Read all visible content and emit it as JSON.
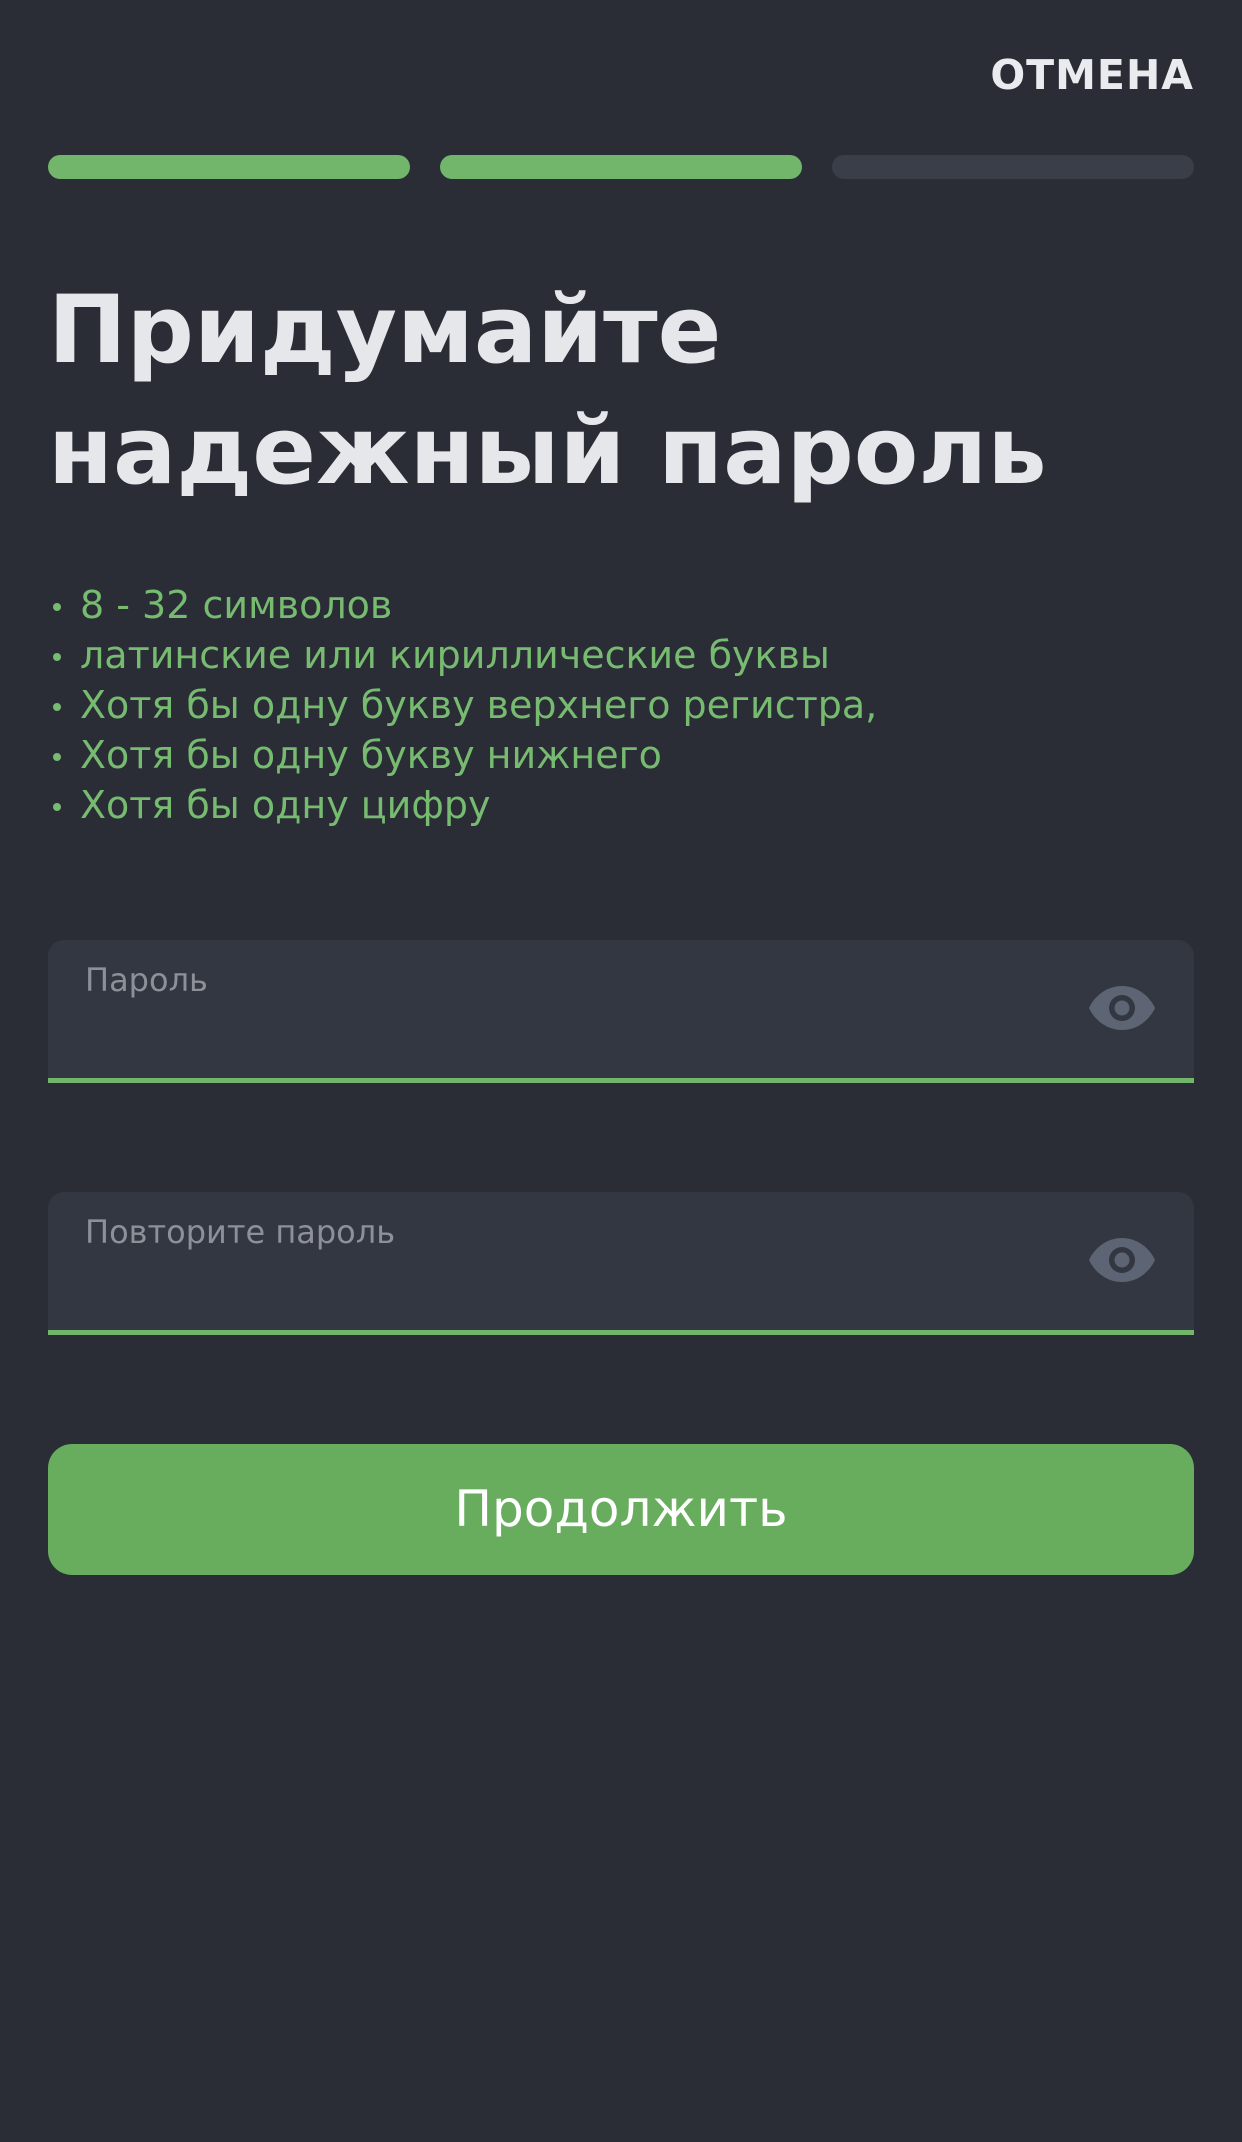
{
  "header": {
    "cancel_label": "ОТМЕНА"
  },
  "progress": {
    "steps_total": 3,
    "steps_completed": 2
  },
  "title": {
    "line1": "Придумайте",
    "line2": "надежный пароль"
  },
  "requirements": [
    "8 - 32 символов",
    "латинские или кириллические буквы",
    "Хотя бы одну букву верхнего регистра,",
    "Хотя бы одну букву нижнего",
    "Хотя бы одну цифру"
  ],
  "password_field": {
    "label": "Пароль",
    "value": ""
  },
  "repeat_field": {
    "label": "Повторите пароль",
    "value": ""
  },
  "continue_button": {
    "label": "Продолжить"
  },
  "colors": {
    "background": "#2a2d36",
    "accent": "#72b66b",
    "button": "#68ad5e",
    "field": "#333741",
    "icon": "#5d6574"
  },
  "icons": {
    "visibility_toggle": "eye-icon"
  }
}
